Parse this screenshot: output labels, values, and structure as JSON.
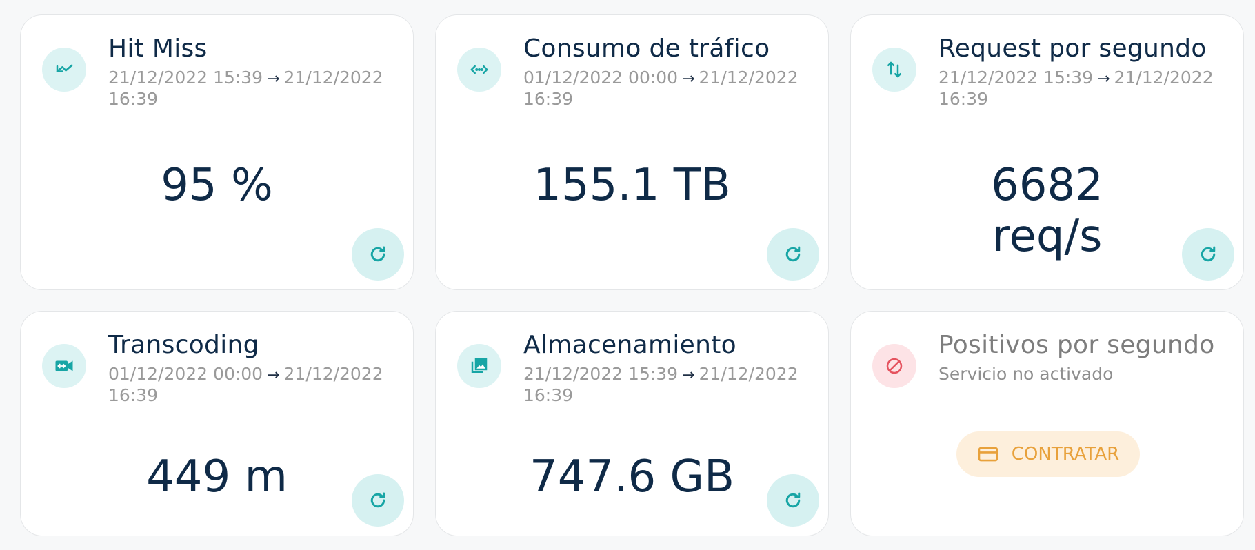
{
  "cards": [
    {
      "title": "Hit Miss",
      "range_from": "21/12/2022 15:39",
      "range_to": "21/12/2022 16:39",
      "value": "95 %",
      "icon": "hit-miss-icon"
    },
    {
      "title": "Consumo de tráfico",
      "range_from": "01/12/2022 00:00",
      "range_to": "21/12/2022 16:39",
      "value": "155.1 TB",
      "icon": "traffic-icon"
    },
    {
      "title": "Request por segundo",
      "range_from": "21/12/2022 15:39",
      "range_to": "21/12/2022 16:39",
      "value_line1": "6682",
      "value_line2": "req/s",
      "icon": "swap-vertical-icon"
    },
    {
      "title": "Transcoding",
      "range_from": "01/12/2022 00:00",
      "range_to": "21/12/2022 16:39",
      "value": "449 m",
      "icon": "video-transcode-icon"
    },
    {
      "title": "Almacenamiento",
      "range_from": "21/12/2022 15:39",
      "range_to": "21/12/2022 16:39",
      "value": "747.6 GB",
      "icon": "photo-library-icon"
    },
    {
      "title": "Positivos por segundo",
      "status": "Servicio no activado",
      "button_label": "CONTRATAR",
      "icon": "blocked-icon"
    }
  ],
  "colors": {
    "accent": "#17a5a5",
    "accent_bg": "#dcf3f3",
    "text_dark": "#0f2a47",
    "danger": "#e5535f",
    "danger_bg": "#fde3e6",
    "warning": "#e8a13b",
    "warning_bg": "#fdefdc"
  }
}
